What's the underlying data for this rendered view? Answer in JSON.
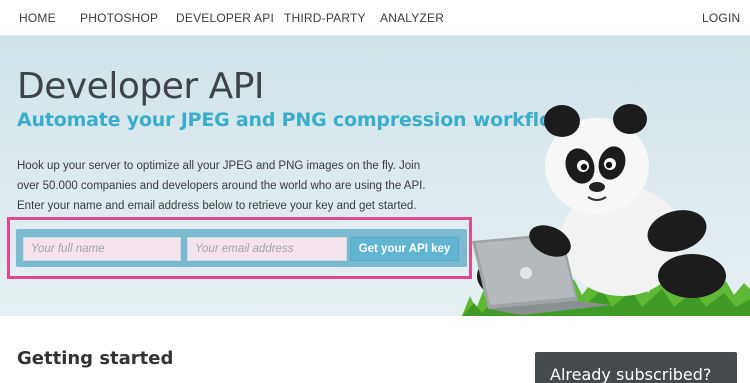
{
  "nav": {
    "items": [
      "HOME",
      "PHOTOSHOP",
      "DEVELOPER API",
      "THIRD-PARTY",
      "ANALYZER"
    ],
    "login": "LOGIN"
  },
  "hero": {
    "title": "Developer API",
    "subtitle": "Automate your JPEG and PNG compression workflow",
    "description_lines": [
      "Hook up your server to optimize all your JPEG and PNG images on the fly. Join",
      "over 50.000 companies and developers around the world who are using the API.",
      "Enter your name and email address below to retrieve your key and get started."
    ],
    "illustration": "panda-with-laptop-icon"
  },
  "form": {
    "name_placeholder": "Your full name",
    "email_placeholder": "Your email address",
    "submit_label": "Get your API key",
    "highlight_color": "#e04891"
  },
  "getting_started": {
    "title": "Getting started"
  },
  "subscribed": {
    "label": "Already subscribed?"
  },
  "colors": {
    "accent": "#39aecb",
    "button": "#62b4d3",
    "form_bar": "#7ab9cf",
    "dark_box": "#444a4e"
  }
}
